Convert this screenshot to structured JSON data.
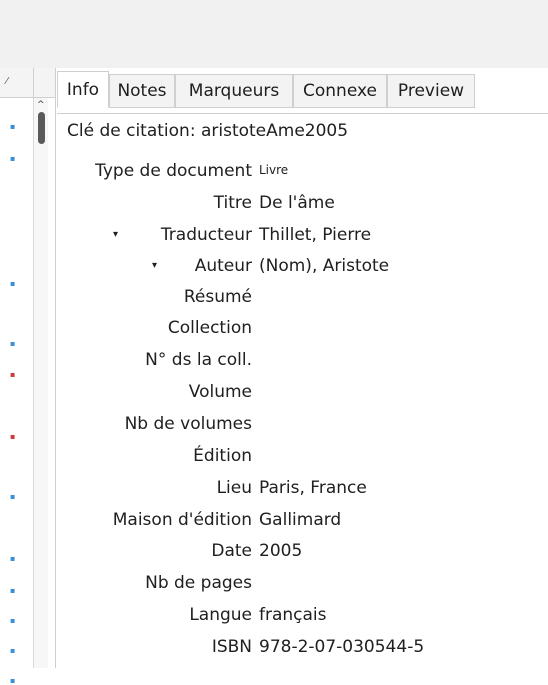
{
  "toolbar": {
    "search_icon_glyph": "⤡",
    "sync_arrow": "➡",
    "sync_chevron": "⌄"
  },
  "left_pane": {
    "header_col1_glyph": "⁄",
    "scroll_up": "^",
    "items": [
      {
        "type": "doc",
        "glyph": "▪"
      },
      {
        "type": "doc",
        "glyph": "▪"
      },
      {
        "type": "doc",
        "glyph": "▪"
      },
      {
        "type": "doc",
        "glyph": "▪"
      },
      {
        "type": "pdf",
        "glyph": "▪"
      },
      {
        "type": "pdf",
        "glyph": "▪"
      },
      {
        "type": "doc",
        "glyph": "▪"
      },
      {
        "type": "doc",
        "glyph": "▪"
      },
      {
        "type": "doc",
        "glyph": "▪"
      },
      {
        "type": "doc",
        "glyph": "▪"
      },
      {
        "type": "doc",
        "glyph": "▪"
      },
      {
        "type": "doc",
        "glyph": "▪"
      }
    ]
  },
  "tabs": [
    "Info",
    "Notes",
    "Marqueurs",
    "Connexe",
    "Preview"
  ],
  "info": {
    "citekey": "Clé de citation: aristoteAme2005",
    "fields": {
      "type_label": "Type de document",
      "type_value": "Livre",
      "title_label": "Titre",
      "title_value": "De l'âme",
      "translator_label": "Traducteur",
      "translator_value": "Thillet, Pierre",
      "author_label": "Auteur",
      "author_value": "(Nom), Aristote",
      "abstract_label": "Résumé",
      "abstract_value": "",
      "series_label": "Collection",
      "series_value": "",
      "series_number_label": "N° ds la coll.",
      "series_number_value": "",
      "volume_label": "Volume",
      "volume_value": "",
      "num_volumes_label": "Nb de volumes",
      "num_volumes_value": "",
      "edition_label": "Édition",
      "edition_value": "",
      "place_label": "Lieu",
      "place_value": "Paris, France",
      "publisher_label": "Maison d'édition",
      "publisher_value": "Gallimard",
      "date_label": "Date",
      "date_value": "2005",
      "pages_label": "Nb de pages",
      "pages_value": "",
      "language_label": "Langue",
      "language_value": "français",
      "isbn_label": "ISBN",
      "isbn_value": "978-2-07-030544-5"
    },
    "expand_glyph": "▾"
  },
  "colors": {
    "toolbar_bg": "#f1f1f1",
    "doc_icon": "#3a8fd6",
    "pdf_icon": "#d23a3a",
    "sync_arrow": "#2fa52f"
  }
}
